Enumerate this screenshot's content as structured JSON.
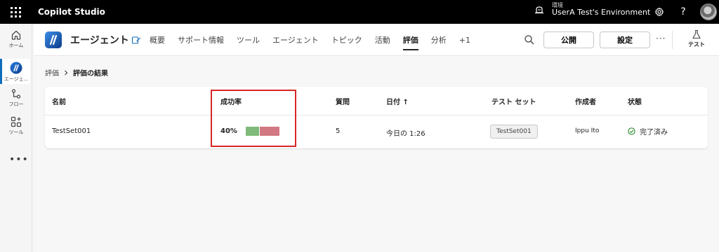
{
  "app": {
    "title": "Copilot Studio"
  },
  "environment": {
    "label": "環境",
    "name": "UserA Test's Environment"
  },
  "topbar": {
    "help_label": "?"
  },
  "rail": {
    "items": [
      {
        "label": "ホーム",
        "icon": "home-icon"
      },
      {
        "label": "エージェ...",
        "icon": "agent-icon",
        "active": true
      },
      {
        "label": "フロー",
        "icon": "flow-icon"
      },
      {
        "label": "ツール",
        "icon": "tools-icon"
      }
    ],
    "more": "•••"
  },
  "header": {
    "agent_title": "エージェント",
    "tabs": [
      {
        "label": "概要"
      },
      {
        "label": "サポート情報"
      },
      {
        "label": "ツール"
      },
      {
        "label": "エージェント"
      },
      {
        "label": "トピック"
      },
      {
        "label": "活動"
      },
      {
        "label": "評価",
        "active": true
      },
      {
        "label": "分析"
      },
      {
        "label": "+1"
      }
    ],
    "publish_label": "公開",
    "settings_label": "設定",
    "more_label": "···",
    "test_label": "テスト"
  },
  "breadcrumb": {
    "parent": "評価",
    "current": "評価の結果"
  },
  "table": {
    "columns": {
      "name": "名前",
      "success_rate": "成功率",
      "questions": "質問",
      "date": "日付 ↑",
      "test_set": "テスト セット",
      "author": "作成者",
      "status": "状態"
    },
    "rows": [
      {
        "name": "TestSet001",
        "success_rate": "40%",
        "success_fraction": 0.4,
        "questions": "5",
        "date": "今日の 1:26",
        "test_set": "TestSet001",
        "author": "Ippu Ito",
        "status": "完了済み"
      }
    ]
  },
  "colors": {
    "accent": "#0f6cbd",
    "pass": "#7fba7a",
    "fail": "#d27882",
    "highlight": "#d92525",
    "success_check": "#107c10"
  }
}
